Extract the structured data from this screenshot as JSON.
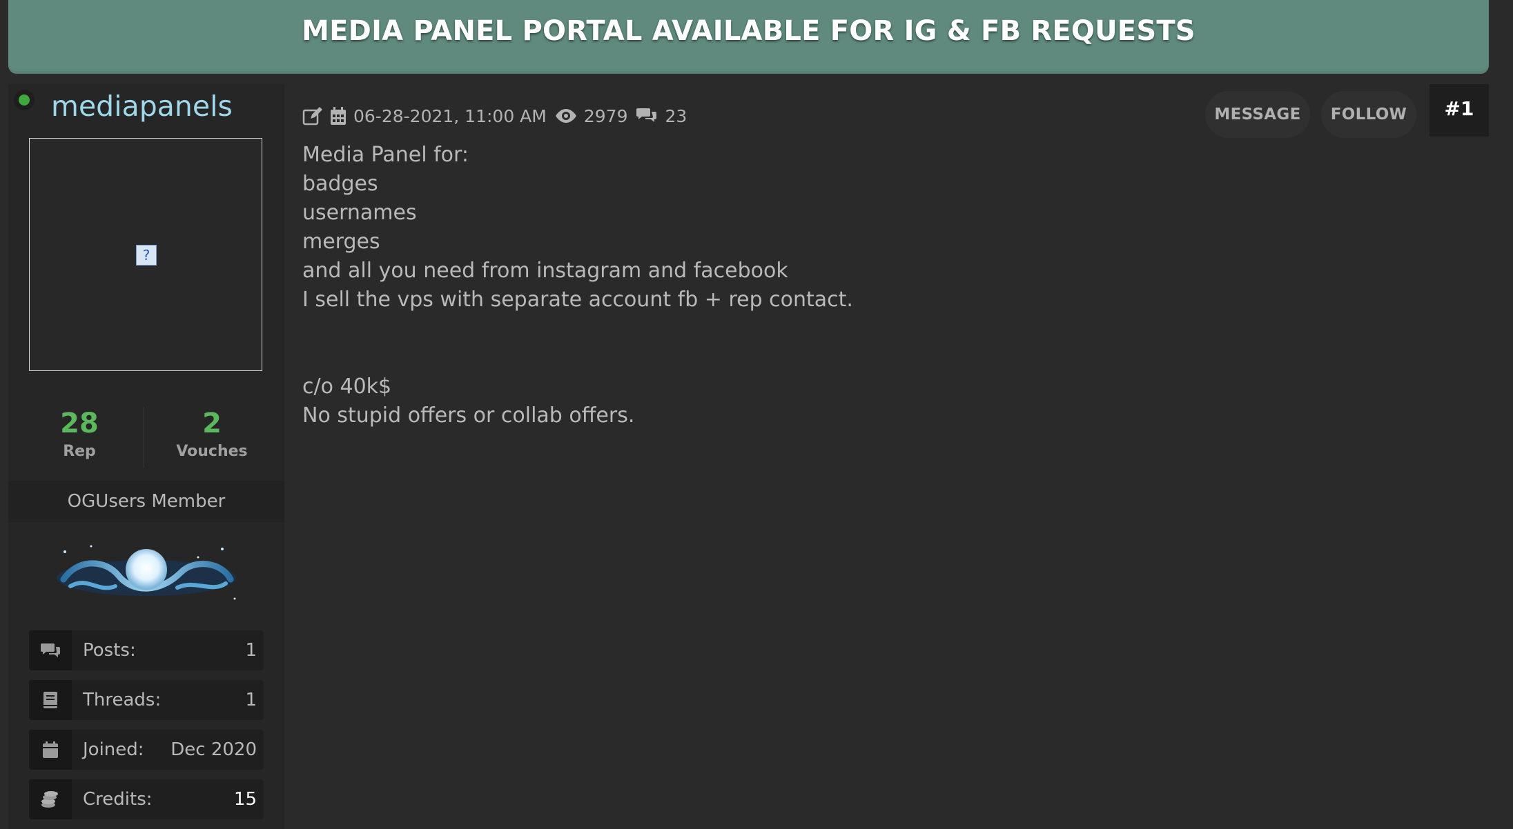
{
  "banner": {
    "title": "MEDIA PANEL PORTAL AVAILABLE FOR IG & FB REQUESTS"
  },
  "author": {
    "username": "mediapanels",
    "status": "online",
    "rep": {
      "value": "28",
      "label": "Rep"
    },
    "vouches": {
      "value": "2",
      "label": "Vouches"
    },
    "group": "OGUsers Member",
    "stats": [
      {
        "icon": "comments-icon",
        "label": "Posts:",
        "value": "1"
      },
      {
        "icon": "book-icon",
        "label": "Threads:",
        "value": "1"
      },
      {
        "icon": "calendar-icon",
        "label": "Joined:",
        "value": "Dec 2020"
      },
      {
        "icon": "coins-icon",
        "label": "Credits:",
        "value": "15"
      }
    ]
  },
  "post": {
    "date": "06-28-2021, 11:00 AM",
    "views": "2979",
    "replies": "23",
    "message_button": "MESSAGE",
    "follow_button": "FOLLOW",
    "number": "#1",
    "lines": [
      "Media Panel for:",
      "badges",
      "usernames",
      "merges",
      "and all you need from instagram and facebook",
      "I sell the vps with separate account fb + rep contact.",
      "",
      "",
      "c/o 40k$",
      "No stupid offers or collab offers."
    ]
  },
  "colors": {
    "banner": "#5f8a7d",
    "username": "#9fd8ea",
    "stat_green": "#5cb85c",
    "online": "#3fa83f"
  }
}
